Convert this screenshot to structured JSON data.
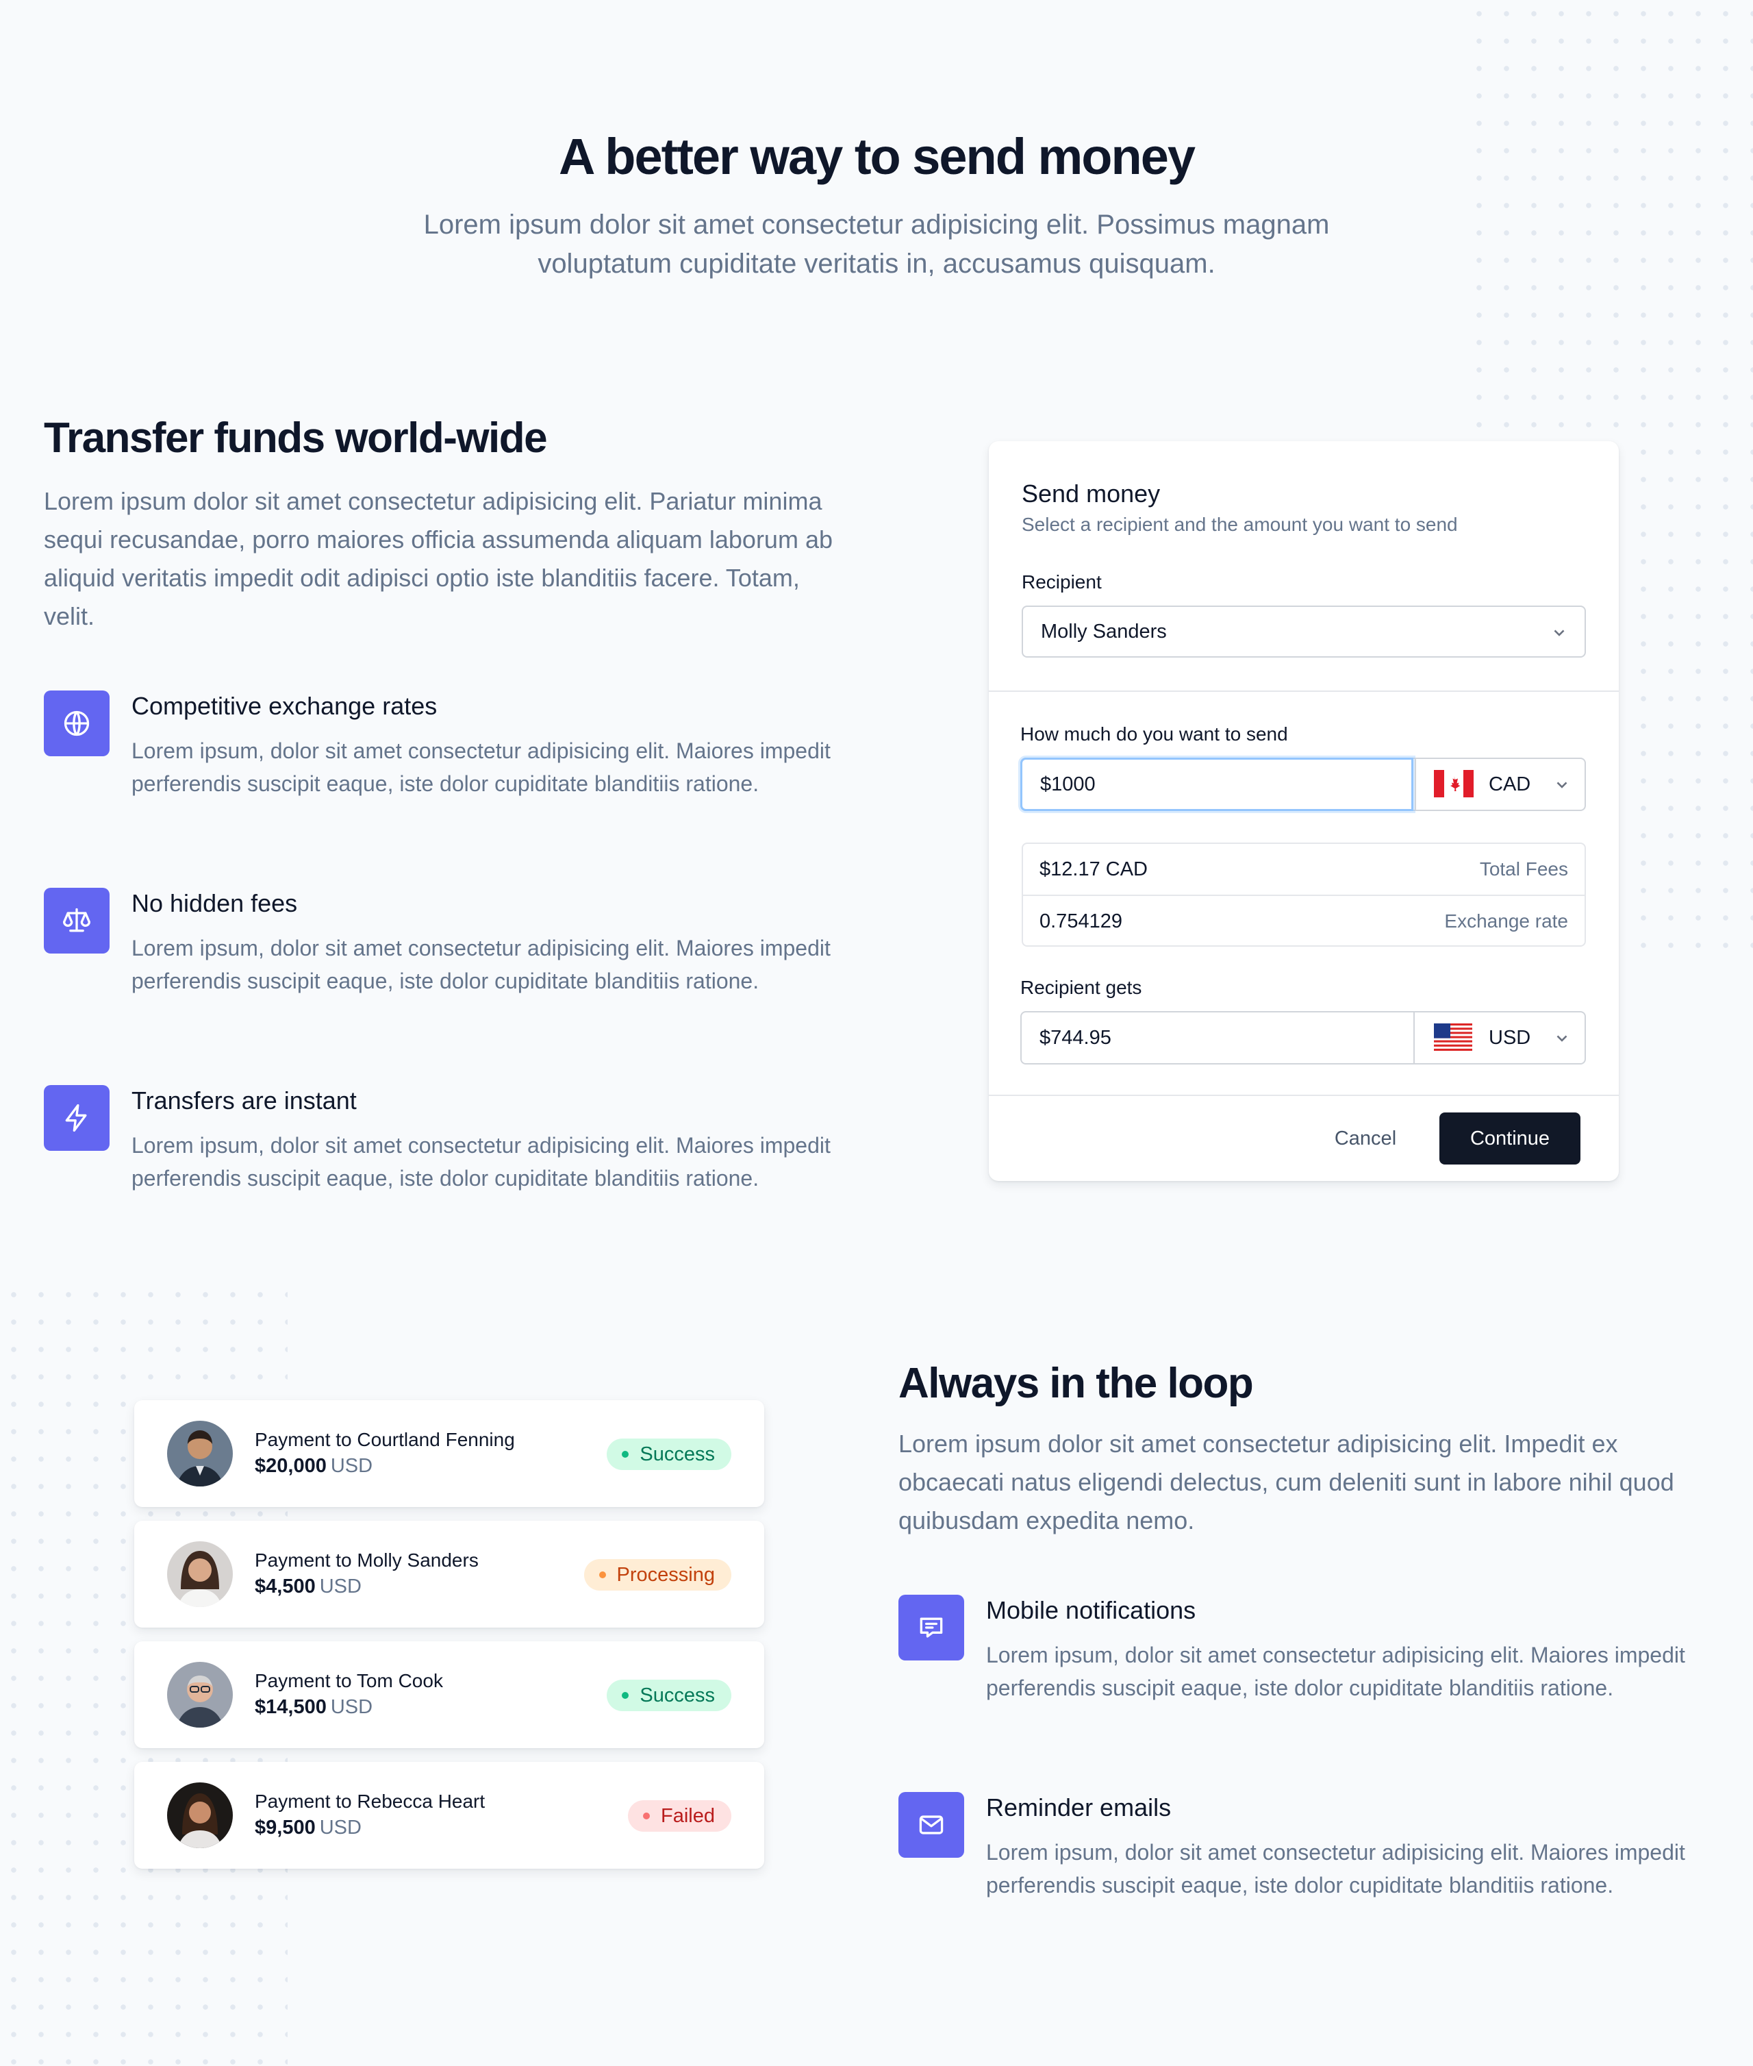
{
  "hero": {
    "title": "A better way to send money",
    "subtitle_line1": "Lorem ipsum dolor sit amet consectetur adipisicing elit. Possimus magnam",
    "subtitle_line2": "voluptatum cupiditate veritatis in, accusamus quisquam."
  },
  "transfer": {
    "title": "Transfer funds world-wide",
    "body": "Lorem ipsum dolor sit amet consectetur adipisicing elit. Pariatur minima sequi recusandae, porro maiores officia assumenda aliquam laborum ab aliquid veritatis impedit odit adipisci optio iste blanditiis facere. Totam, velit.",
    "features": [
      {
        "icon": "globe-icon",
        "title": "Competitive exchange rates",
        "desc": "Lorem ipsum, dolor sit amet consectetur adipisicing elit. Maiores impedit perferendis suscipit eaque, iste dolor cupiditate blanditiis ratione."
      },
      {
        "icon": "scale-icon",
        "title": "No hidden fees",
        "desc": "Lorem ipsum, dolor sit amet consectetur adipisicing elit. Maiores impedit perferendis suscipit eaque, iste dolor cupiditate blanditiis ratione."
      },
      {
        "icon": "lightning-bolt-icon",
        "title": "Transfers are instant",
        "desc": "Lorem ipsum, dolor sit amet consectetur adipisicing elit. Maiores impedit perferendis suscipit eaque, iste dolor cupiditate blanditiis ratione."
      }
    ]
  },
  "send_card": {
    "title": "Send money",
    "subtitle": "Select a recipient and the amount you want to send",
    "recipient_label": "Recipient",
    "recipient_value": "Molly Sanders",
    "amount_label": "How much do you want to send",
    "amount_value": "$1000",
    "from_currency": "CAD",
    "fees_value": "$12.17 CAD",
    "fees_label": "Total Fees",
    "rate_value": "0.754129",
    "rate_label": "Exchange rate",
    "gets_label": "Recipient gets",
    "gets_value": "$744.95",
    "to_currency": "USD",
    "cancel_label": "Cancel",
    "continue_label": "Continue"
  },
  "payments": [
    {
      "title": "Payment to Courtland Fenning",
      "amount": "$20,000",
      "currency": "USD",
      "status": "Success"
    },
    {
      "title": "Payment to Molly Sanders",
      "amount": "$4,500",
      "currency": "USD",
      "status": "Processing"
    },
    {
      "title": "Payment to Tom Cook",
      "amount": "$14,500",
      "currency": "USD",
      "status": "Success"
    },
    {
      "title": "Payment to Rebecca Heart",
      "amount": "$9,500",
      "currency": "USD",
      "status": "Failed"
    }
  ],
  "loop": {
    "title": "Always in the loop",
    "body": "Lorem ipsum dolor sit amet consectetur adipisicing elit. Impedit ex obcaecati natus eligendi delectus, cum deleniti sunt in labore nihil quod quibusdam expedita nemo.",
    "features": [
      {
        "icon": "chat-icon",
        "title": "Mobile notifications",
        "desc": "Lorem ipsum, dolor sit amet consectetur adipisicing elit. Maiores impedit perferendis suscipit eaque, iste dolor cupiditate blanditiis ratione."
      },
      {
        "icon": "mail-icon",
        "title": "Reminder emails",
        "desc": "Lorem ipsum, dolor sit amet consectetur adipisicing elit. Maiores impedit perferendis suscipit eaque, iste dolor cupiditate blanditiis ratione."
      }
    ]
  },
  "colors": {
    "accent": "#6366f1",
    "success_bg": "#d1fae5",
    "success_fg": "#047857",
    "success_dot": "#10b981",
    "processing_bg": "#ffedd5",
    "processing_fg": "#c2410c",
    "processing_dot": "#fb923c",
    "failed_bg": "#fee2e2",
    "failed_fg": "#b91c1c",
    "failed_dot": "#f87171"
  }
}
